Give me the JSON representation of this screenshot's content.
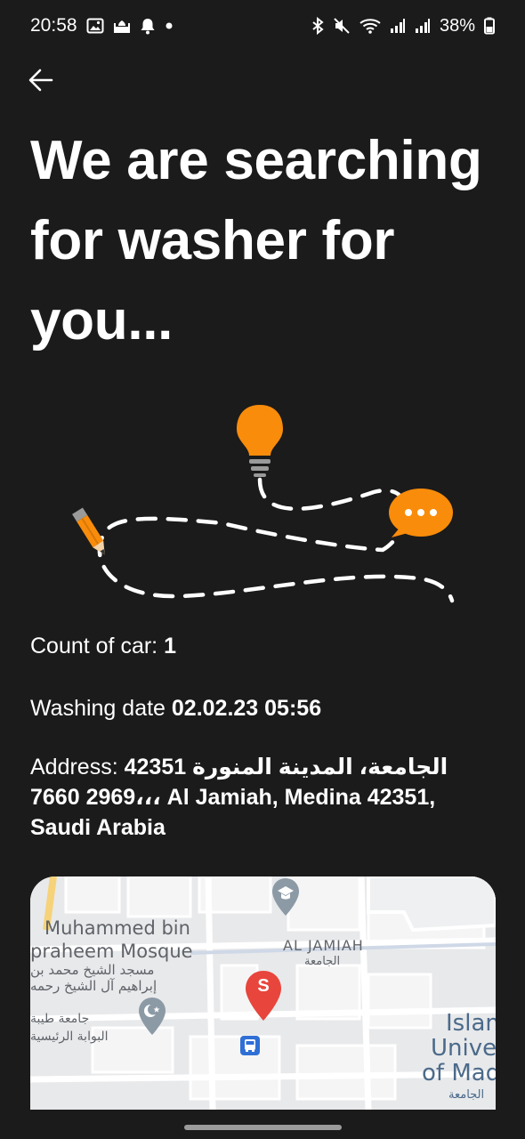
{
  "status_bar": {
    "time": "20:58",
    "battery": "38%",
    "left_icons": [
      "image-icon",
      "mosque-icon",
      "bell-icon",
      "dot-icon"
    ],
    "right_icons": [
      "bluetooth-icon",
      "mute-icon",
      "wifi-icon",
      "signal-icon",
      "signal-icon",
      "battery-icon"
    ]
  },
  "header": {
    "back_icon": "arrow-left-icon",
    "title": "We are searching for washer for you..."
  },
  "illustration": {
    "icons": [
      "lightbulb-icon",
      "pencil-icon",
      "chat-bubble-icon"
    ],
    "accent_color": "#f98c0b"
  },
  "details": {
    "count_label": "Count of car: ",
    "count_value": "1",
    "date_label": "Washing date ",
    "date_value": "02.02.23 05:56",
    "address_label": "Address: ",
    "address_value": "الجامعة، المدينة المنورة 42351 ،2969 7660،، Al Jamiah, Medina 42351, Saudi Arabia"
  },
  "map": {
    "labels": {
      "mosque_en_1": "Muhammed bin",
      "mosque_en_2": "praheem Mosque",
      "mosque_ar_1": "مسجد الشيخ محمد بن",
      "mosque_ar_2": "إبراهيم آل الشيخ رحمه",
      "district_en": "AL JAMIAH",
      "district_ar": "الجامعة",
      "gate_ar_1": "جامعة طيبة",
      "gate_ar_2": "البوابة الرئيسية",
      "uni_1": "Islam",
      "uni_2": "Unive",
      "uni_3": "of Mad",
      "uni_ar": "الجامعة"
    },
    "marker_letter": "S",
    "marker_color": "#e8453c",
    "icons": [
      "university-icon",
      "mosque-pin-icon",
      "bus-stop-icon",
      "map-marker-icon"
    ]
  }
}
